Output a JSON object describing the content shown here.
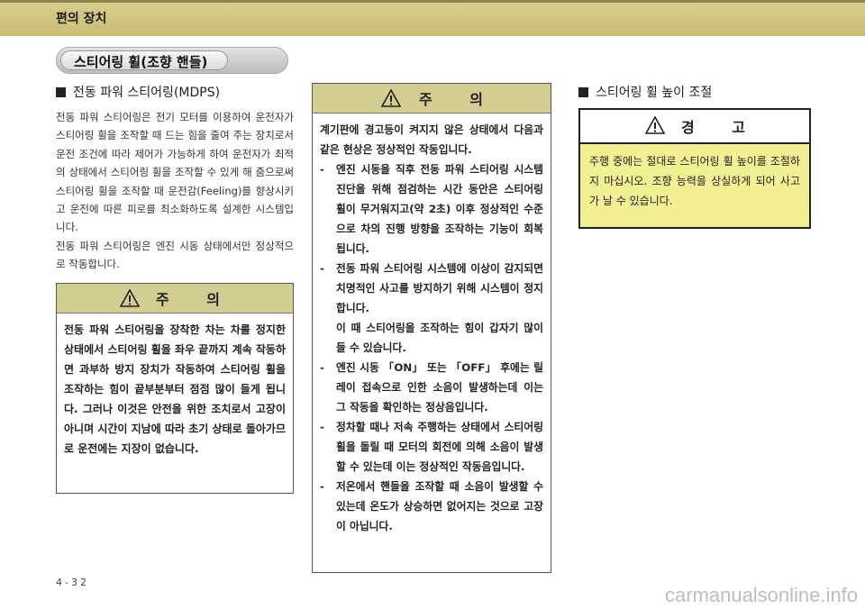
{
  "header": {
    "title": "편의 장치"
  },
  "section": {
    "title": "스티어링 휠(조향 핸들)"
  },
  "left": {
    "heading": "전동 파워 스티어링(MDPS)",
    "paragraphs": [
      "전동 파워 스티어링은 전기 모터를 이용하여 운전자가 스티어링 휠을 조작할 때 드는 힘을 줄여 주는 장치로서 운전 조건에 따라 제어가 가능하게 하여 운전자가 최적의 상태에서 스티어링 휠을 조작할 수 있게 해 줌으로써 스티어링 휠을 조작할 때 운전감(Feeling)를 향상시키고 운전에 따른 피로를 최소화하도록 설계한 시스템입니다.",
      "전동 파워 스티어링은 엔진 시동 상태에서만 정상적으로 작동합니다."
    ],
    "caution": {
      "title": "주 의",
      "text": "전동 파워 스티어링을 장착한 차는 차를 정지한 상태에서 스티어링 휠을 좌우 끝까지 계속 작동하면 과부하 방지 장치가 작동하여 스티어링 휠을 조작하는 힘이 끝부분부터 점점 많이 들게 됩니다. 그러나 이것은 안전을 위한 조치로서 고장이 아니며 시간이 지남에 따라 초기 상태로 돌아가므로 운전에는 지장이 없습니다."
    }
  },
  "middle": {
    "caution": {
      "title": "주 의",
      "intro": "계기판에 경고등이 켜지지 않은 상태에서 다음과 같은 현상은 정상적인 작동입니다.",
      "items": [
        {
          "dash": "-",
          "text": "엔진 시동을 직후 전동 파워 스티어링 시스템 진단을 위해 점검하는 시간 동안은 스티어링 휠이 무거워지고(약 2초) 이후 정상적인 수준으로 차의 진행 방향을 조작하는 기능이 회복됩니다."
        },
        {
          "dash": "-",
          "text": "전동 파워 스티어링 시스템에 이상이 감지되면 치명적인 사고를 방지하기 위해 시스템이 정지합니다.",
          "extra": "이 때 스티어링을 조작하는 힘이 갑자기 많이 들 수 있습니다."
        },
        {
          "dash": "-",
          "text": "엔진 시동 「ON」 또는 「OFF」 후에는 릴레이 접속으로 인한 소음이 발생하는데 이는 그 작동을 확인하는 정상음입니다."
        },
        {
          "dash": "-",
          "text": "정차할 때나 저속 주행하는 상태에서 스티어링 휠을 돌릴 때 모터의 회전에 의해 소음이 발생할 수 있는데 이는 정상적인 작동음입니다."
        },
        {
          "dash": "-",
          "text": "저온에서 핸들을 조작할 때 소음이 발생할 수 있는데 온도가 상승하면 없어지는 것으로 고장이 아닙니다."
        }
      ]
    }
  },
  "right": {
    "heading": "스티어링 휠 높이 조절",
    "warning": {
      "title": "경 고",
      "text": "주행 중에는 절대로 스티어링 휠 높이를 조절하지 마십시오. 조향 능력을 상실하게 되어 사고가 날 수 있습니다."
    }
  },
  "footer": {
    "page": "4-32",
    "watermark": "carmanualsonline.info"
  }
}
